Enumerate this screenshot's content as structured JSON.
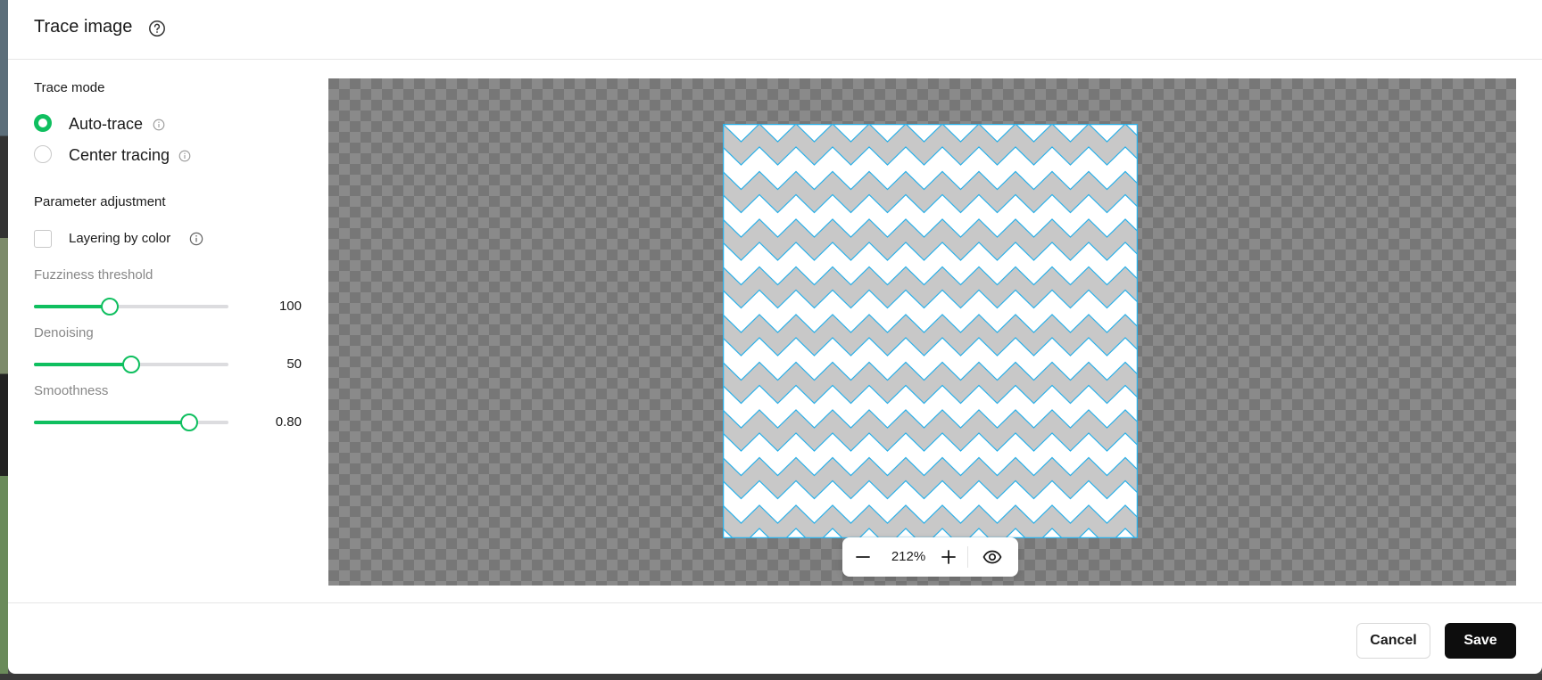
{
  "dialog": {
    "title": "Trace image",
    "help_icon": "question-circle-icon"
  },
  "trace_mode": {
    "heading": "Trace mode",
    "options": [
      {
        "label": "Auto-trace",
        "selected": true,
        "info_icon": "info-icon"
      },
      {
        "label": "Center tracing",
        "selected": false,
        "info_icon": "info-icon"
      }
    ]
  },
  "parameters": {
    "heading": "Parameter adjustment",
    "layering": {
      "label": "Layering by color",
      "checked": false,
      "info_icon": "info-icon"
    },
    "sliders": [
      {
        "label": "Fuzziness threshold",
        "value": "100",
        "fraction": 0.39
      },
      {
        "label": "Denoising",
        "value": "50",
        "fraction": 0.5
      },
      {
        "label": "Smoothness",
        "value": "0.80",
        "fraction": 0.8
      }
    ]
  },
  "preview": {
    "zoom_level": "212%",
    "zoom_out_icon": "minus-icon",
    "zoom_in_icon": "plus-icon",
    "preview_icon": "eye-icon",
    "pattern_colors": {
      "fill": "#c8c8c8",
      "stroke": "#2bb0e8",
      "background": "#ffffff"
    }
  },
  "footer": {
    "cancel_label": "Cancel",
    "save_label": "Save"
  },
  "colors": {
    "accent": "#0fbf5f",
    "primary_button": "#0d0d0d"
  }
}
